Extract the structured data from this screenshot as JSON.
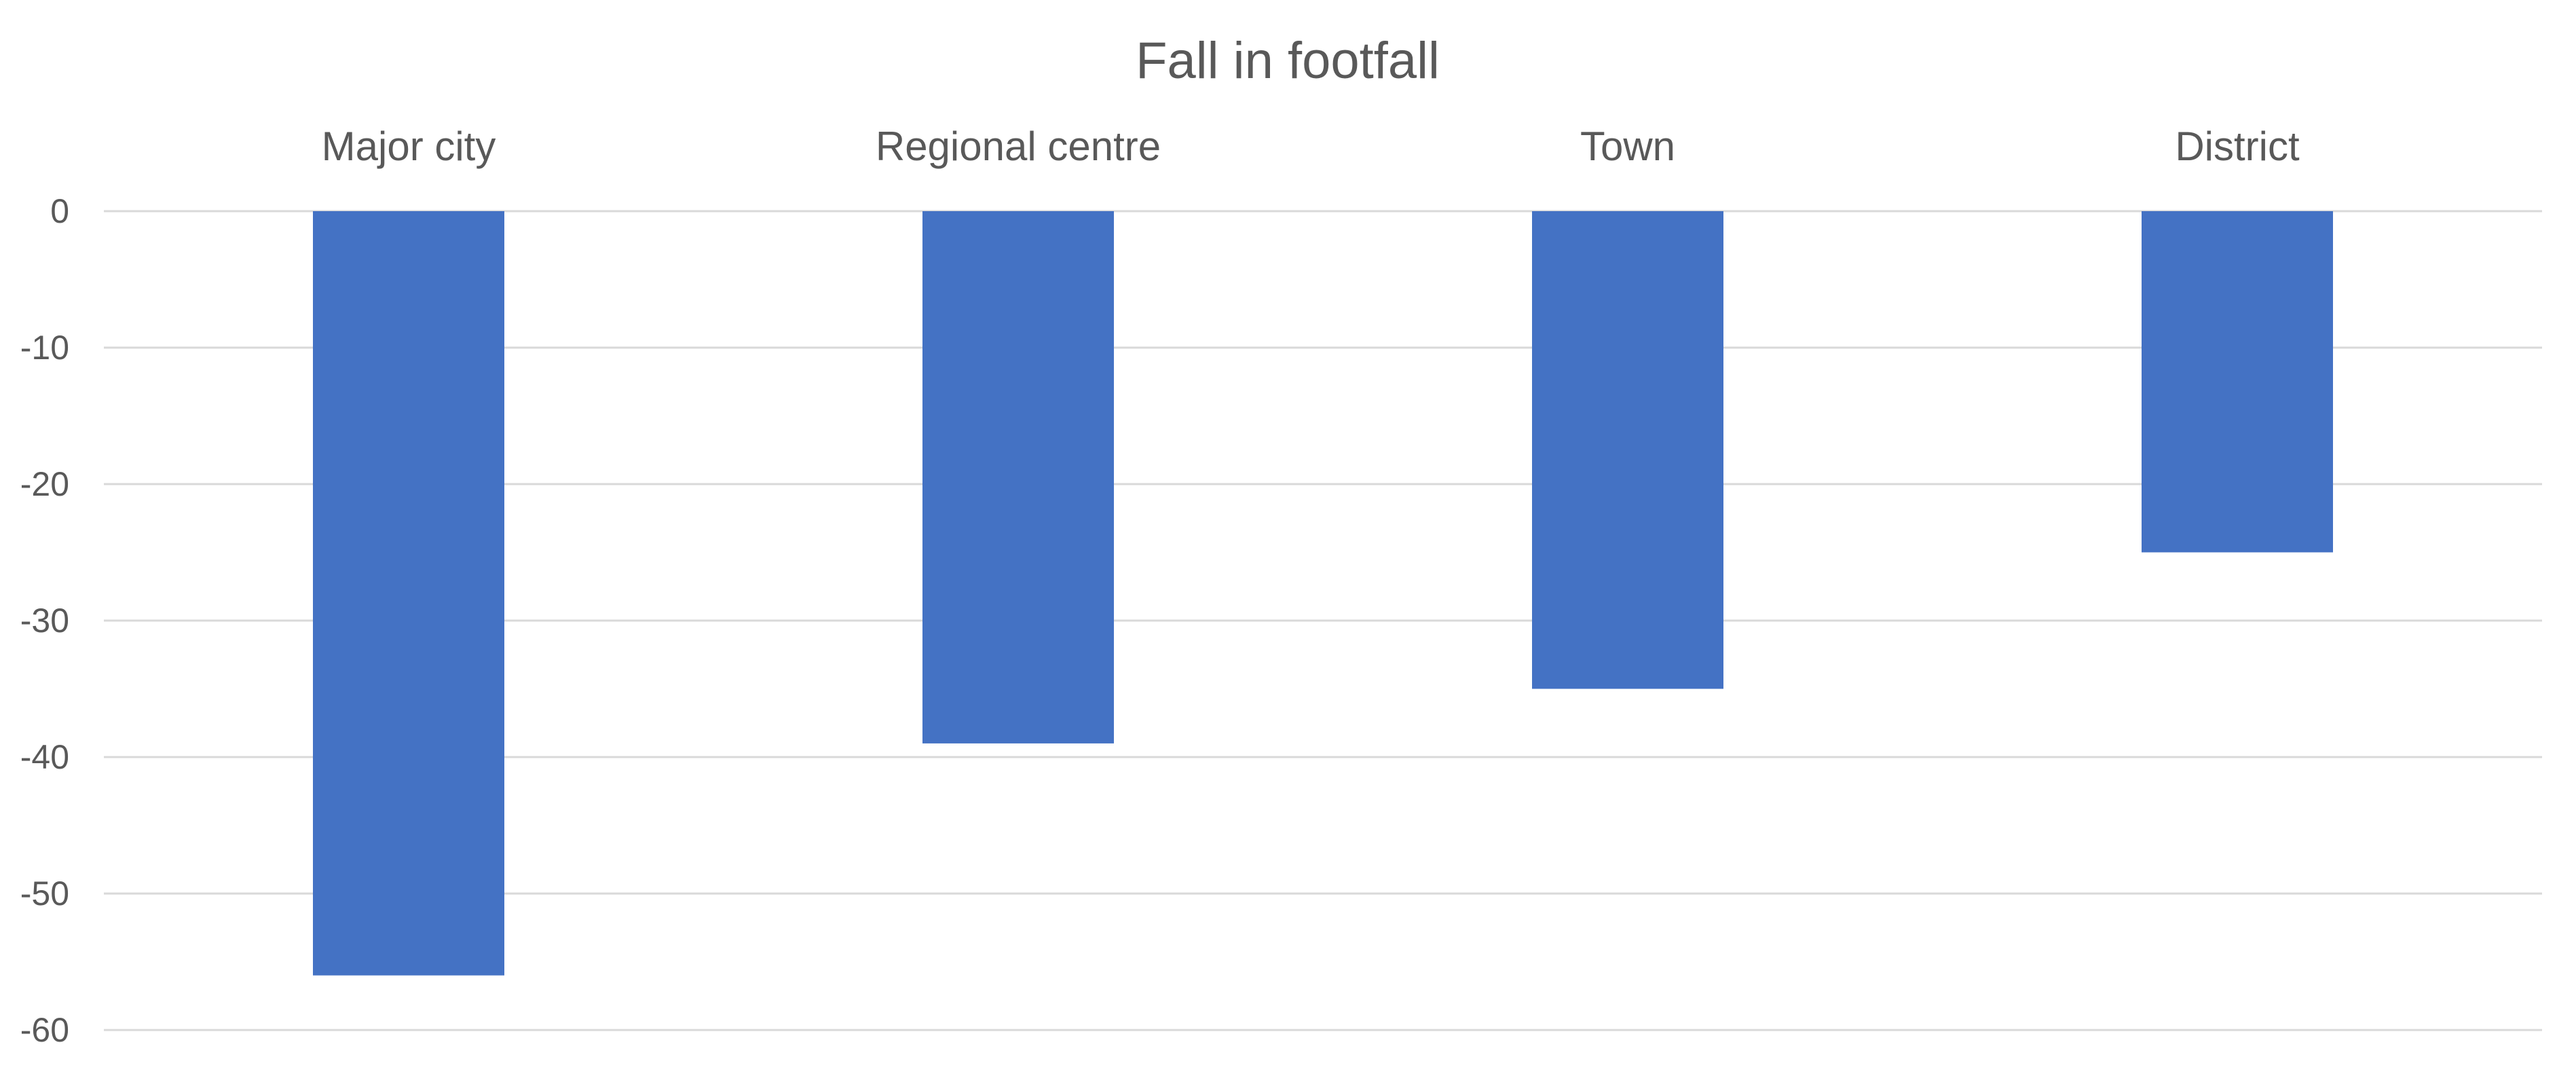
{
  "chart_data": {
    "type": "bar",
    "title": "Fall in footfall",
    "categories": [
      "Major city",
      "Regional centre",
      "Town",
      "District"
    ],
    "values": [
      -56,
      -39,
      -35,
      -25
    ],
    "xlabel": "",
    "ylabel": "",
    "ylim": [
      -60,
      0
    ],
    "yticks": [
      0,
      -10,
      -20,
      -30,
      -40,
      -50,
      -60
    ],
    "ytick_labels": [
      "0",
      "-10",
      "-20",
      "-30",
      "-40",
      "-50",
      "-60"
    ],
    "category_axis_position": "top",
    "grid": true,
    "legend": "none",
    "colors": {
      "bar": "#4472C4",
      "grid": "#D9D9D9",
      "text": "#595959"
    }
  }
}
